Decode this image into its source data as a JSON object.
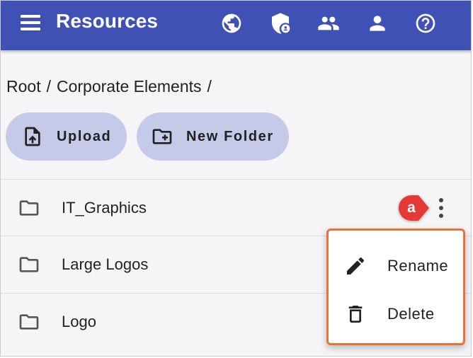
{
  "header": {
    "title": "Resources",
    "bg_color": "#3f51b5",
    "icons": [
      "menu-icon",
      "globe-icon",
      "shield-account-icon",
      "group-icon",
      "person-icon",
      "help-icon"
    ]
  },
  "breadcrumb": {
    "items": [
      "Root",
      "Corporate Elements"
    ],
    "separator": "/"
  },
  "actions": {
    "upload_label": "Upload",
    "new_folder_label": "New Folder",
    "button_color": "#c5cae9"
  },
  "folders": [
    {
      "name": "IT_Graphics"
    },
    {
      "name": "Large Logos"
    },
    {
      "name": "Logo"
    }
  ],
  "annotation": {
    "label": "a",
    "color": "#e53935"
  },
  "context_menu": {
    "border_color": "#e8733a",
    "items": [
      {
        "label": "Rename",
        "icon": "pencil-icon"
      },
      {
        "label": "Delete",
        "icon": "trash-icon"
      }
    ]
  }
}
